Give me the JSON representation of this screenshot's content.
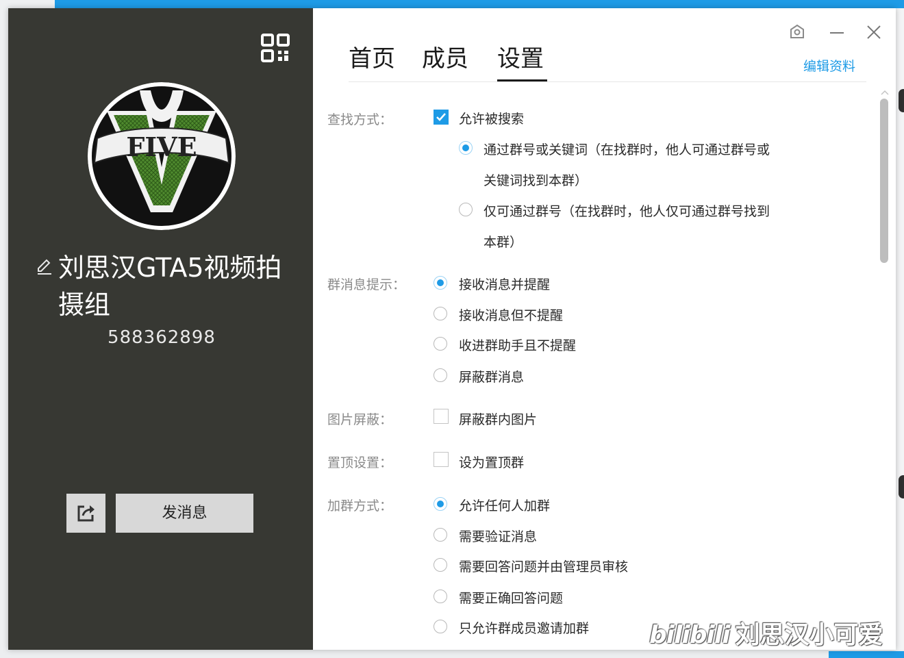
{
  "group": {
    "name": "刘思汉GTA5视频拍摄组",
    "number": "588362898",
    "avatar_text": "FIVE"
  },
  "left_panel": {
    "send_message_label": "发消息"
  },
  "tabs": [
    {
      "label": "首页",
      "active": false
    },
    {
      "label": "成员",
      "active": false
    },
    {
      "label": "设置",
      "active": true
    }
  ],
  "header": {
    "edit_profile_label": "编辑资料"
  },
  "settings": {
    "search": {
      "label": "查找方式：",
      "allow_search_label": "允许被搜索",
      "allow_search_checked": true,
      "options": [
        {
          "label": "通过群号或关键词（在找群时，他人可通过群号或",
          "continuation": "关键词找到本群）",
          "selected": true
        },
        {
          "label": "仅可通过群号（在找群时，他人仅可通过群号找到",
          "continuation": "本群）",
          "selected": false
        }
      ]
    },
    "notification": {
      "label": "群消息提示：",
      "options": [
        {
          "label": "接收消息并提醒",
          "selected": true
        },
        {
          "label": "接收消息但不提醒",
          "selected": false
        },
        {
          "label": "收进群助手且不提醒",
          "selected": false
        },
        {
          "label": "屏蔽群消息",
          "selected": false
        }
      ]
    },
    "image_block": {
      "label": "图片屏蔽：",
      "option_label": "屏蔽群内图片",
      "checked": false
    },
    "pin": {
      "label": "置顶设置：",
      "option_label": "设为置顶群",
      "checked": false
    },
    "join": {
      "label": "加群方式：",
      "options": [
        {
          "label": "允许任何人加群",
          "selected": true
        },
        {
          "label": "需要验证消息",
          "selected": false
        },
        {
          "label": "需要回答问题并由管理员审核",
          "selected": false
        },
        {
          "label": "需要正确回答问题",
          "selected": false
        },
        {
          "label": "只允许群成员邀请加群",
          "selected": false
        }
      ]
    }
  },
  "watermark": {
    "brand": "bilibili",
    "author": "刘思汉小可爱"
  },
  "colors": {
    "left_panel_bg": "#373833",
    "accent": "#1e9be6",
    "label_gray": "#8a8a8a",
    "button_gray": "#d8d8d8"
  },
  "icons": [
    "qr-code-icon",
    "edit-pencil-icon",
    "share-icon",
    "skin-icon",
    "minimize-icon",
    "close-icon",
    "checkmark-icon",
    "mouse-cursor-icon"
  ]
}
